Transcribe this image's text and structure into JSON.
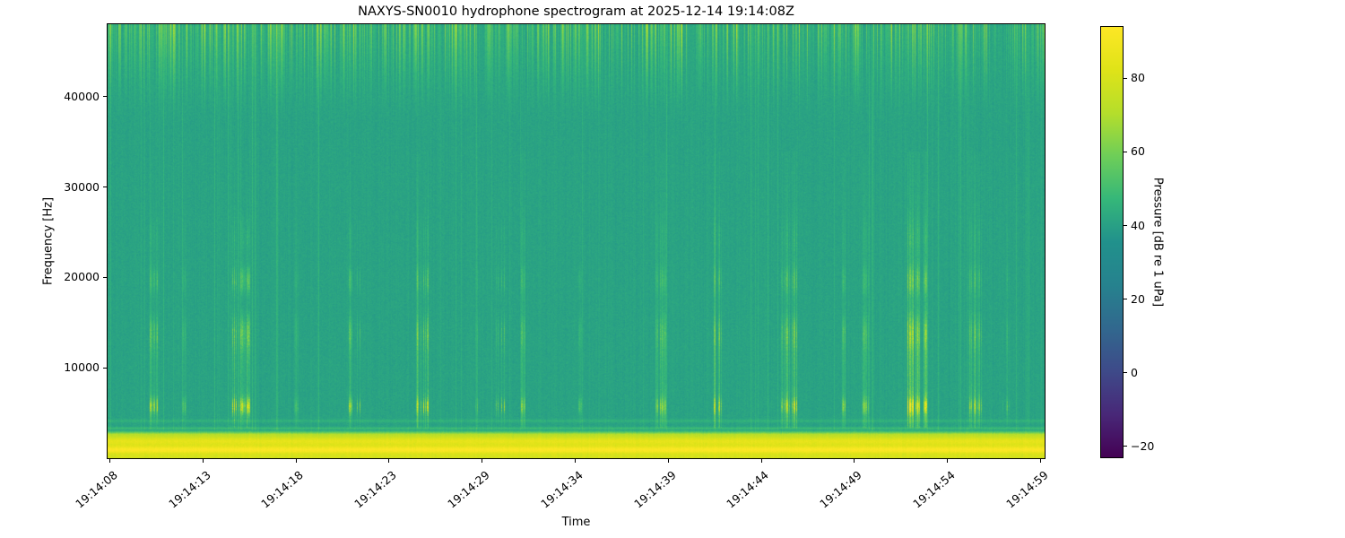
{
  "figure": {
    "background": "#ffffff",
    "text_color": "#000000"
  },
  "chart_data": {
    "type": "heatmap",
    "subtype": "spectrogram",
    "title": "NAXYS-SN0010 hydrophone spectrogram at 2025-12-14 19:14:08Z",
    "xlabel": "Time",
    "ylabel": "Frequency [Hz]",
    "colormap": "viridis",
    "grid": false,
    "freq_range_hz": [
      0,
      48000
    ],
    "time_range": [
      "19:14:08",
      "19:14:59"
    ],
    "x_tick_labels": [
      "19:14:08",
      "19:14:13",
      "19:14:18",
      "19:14:23",
      "19:14:29",
      "19:14:34",
      "19:14:39",
      "19:14:44",
      "19:14:49",
      "19:14:54",
      "19:14:59"
    ],
    "y_ticks": [
      {
        "hz": 10000,
        "label": "10000"
      },
      {
        "hz": 20000,
        "label": "20000"
      },
      {
        "hz": 30000,
        "label": "30000"
      },
      {
        "hz": 40000,
        "label": "40000"
      }
    ],
    "colorbar": {
      "label": "Pressure [dB re 1 uPa]",
      "vmin": -23,
      "vmax": 94,
      "ticks": [
        {
          "value": 80,
          "label": "80"
        },
        {
          "value": 60,
          "label": "60"
        },
        {
          "value": 40,
          "label": "40"
        },
        {
          "value": 20,
          "label": "20"
        },
        {
          "value": 0,
          "label": "0"
        },
        {
          "value": -20,
          "label": "−20"
        }
      ],
      "viridis_stops": [
        [
          68,
          1,
          84
        ],
        [
          72,
          40,
          120
        ],
        [
          62,
          74,
          137
        ],
        [
          49,
          104,
          142
        ],
        [
          38,
          130,
          142
        ],
        [
          33,
          145,
          140
        ],
        [
          53,
          183,
          121
        ],
        [
          110,
          206,
          88
        ],
        [
          181,
          222,
          43
        ],
        [
          223,
          227,
          24
        ],
        [
          253,
          231,
          37
        ]
      ]
    },
    "noise_model": {
      "background_level_db": 41,
      "pixel_noise_db": 2.6,
      "column_noise_db": 1.2,
      "low_band": {
        "freq_max_hz": 3100,
        "peak_db": 90,
        "peak_center_hz": 950,
        "secondary_center_hz": 2150
      },
      "tonal_lines_hz": [
        3360,
        4180
      ],
      "hf_stripe_band_hz": [
        36500,
        48000
      ],
      "hf_stripe_max_boost_db": 26,
      "faint_vertical_line_prob": 0.055
    },
    "events": [
      {
        "t_frac": 0.05,
        "strength_db": 24,
        "width_frac": 0.012,
        "kind": "cluster"
      },
      {
        "t_frac": 0.081,
        "strength_db": 9,
        "width_frac": 0.004,
        "kind": "line"
      },
      {
        "t_frac": 0.142,
        "strength_db": 27,
        "width_frac": 0.018,
        "kind": "cluster"
      },
      {
        "t_frac": 0.201,
        "strength_db": 8,
        "width_frac": 0.004,
        "kind": "line"
      },
      {
        "t_frac": 0.263,
        "strength_db": 18,
        "width_frac": 0.011,
        "kind": "cluster"
      },
      {
        "t_frac": 0.335,
        "strength_db": 24,
        "width_frac": 0.014,
        "kind": "cluster"
      },
      {
        "t_frac": 0.392,
        "strength_db": 10,
        "width_frac": 0.005,
        "kind": "cluster"
      },
      {
        "t_frac": 0.419,
        "strength_db": 17,
        "width_frac": 0.009,
        "kind": "cluster"
      },
      {
        "t_frac": 0.443,
        "strength_db": 13,
        "width_frac": 0.003,
        "kind": "tall-line"
      },
      {
        "t_frac": 0.504,
        "strength_db": 8,
        "width_frac": 0.003,
        "kind": "line"
      },
      {
        "t_frac": 0.59,
        "strength_db": 18,
        "width_frac": 0.011,
        "kind": "tall-cluster"
      },
      {
        "t_frac": 0.651,
        "strength_db": 22,
        "width_frac": 0.008,
        "kind": "tall-cluster"
      },
      {
        "t_frac": 0.727,
        "strength_db": 25,
        "width_frac": 0.016,
        "kind": "tall-cluster"
      },
      {
        "t_frac": 0.785,
        "strength_db": 13,
        "width_frac": 0.003,
        "kind": "tall-line"
      },
      {
        "t_frac": 0.808,
        "strength_db": 17,
        "width_frac": 0.007,
        "kind": "tall-cluster"
      },
      {
        "t_frac": 0.864,
        "strength_db": 32,
        "width_frac": 0.02,
        "kind": "tall-cluster"
      },
      {
        "t_frac": 0.926,
        "strength_db": 20,
        "width_frac": 0.012,
        "kind": "tall-cluster"
      },
      {
        "t_frac": 0.958,
        "strength_db": 9,
        "width_frac": 0.007,
        "kind": "cluster"
      }
    ]
  }
}
